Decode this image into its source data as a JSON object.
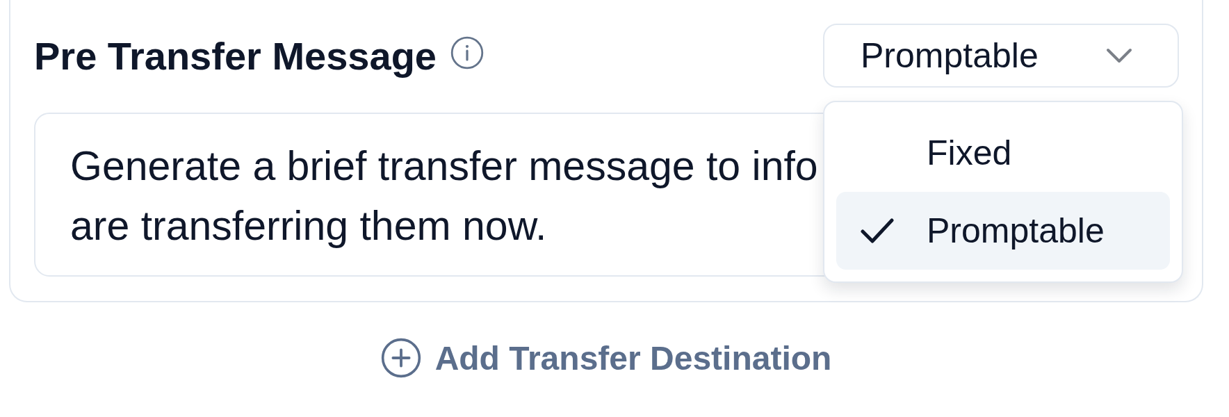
{
  "section": {
    "title": "Pre Transfer Message",
    "mode_select": {
      "value": "Promptable",
      "expanded": true,
      "options": [
        {
          "label": "Fixed",
          "selected": false
        },
        {
          "label": "Promptable",
          "selected": true
        }
      ]
    },
    "message": {
      "lines": [
        "Generate a brief transfer message to info",
        "are transferring them now."
      ]
    }
  },
  "add_button": {
    "label": "Add Transfer Destination"
  }
}
